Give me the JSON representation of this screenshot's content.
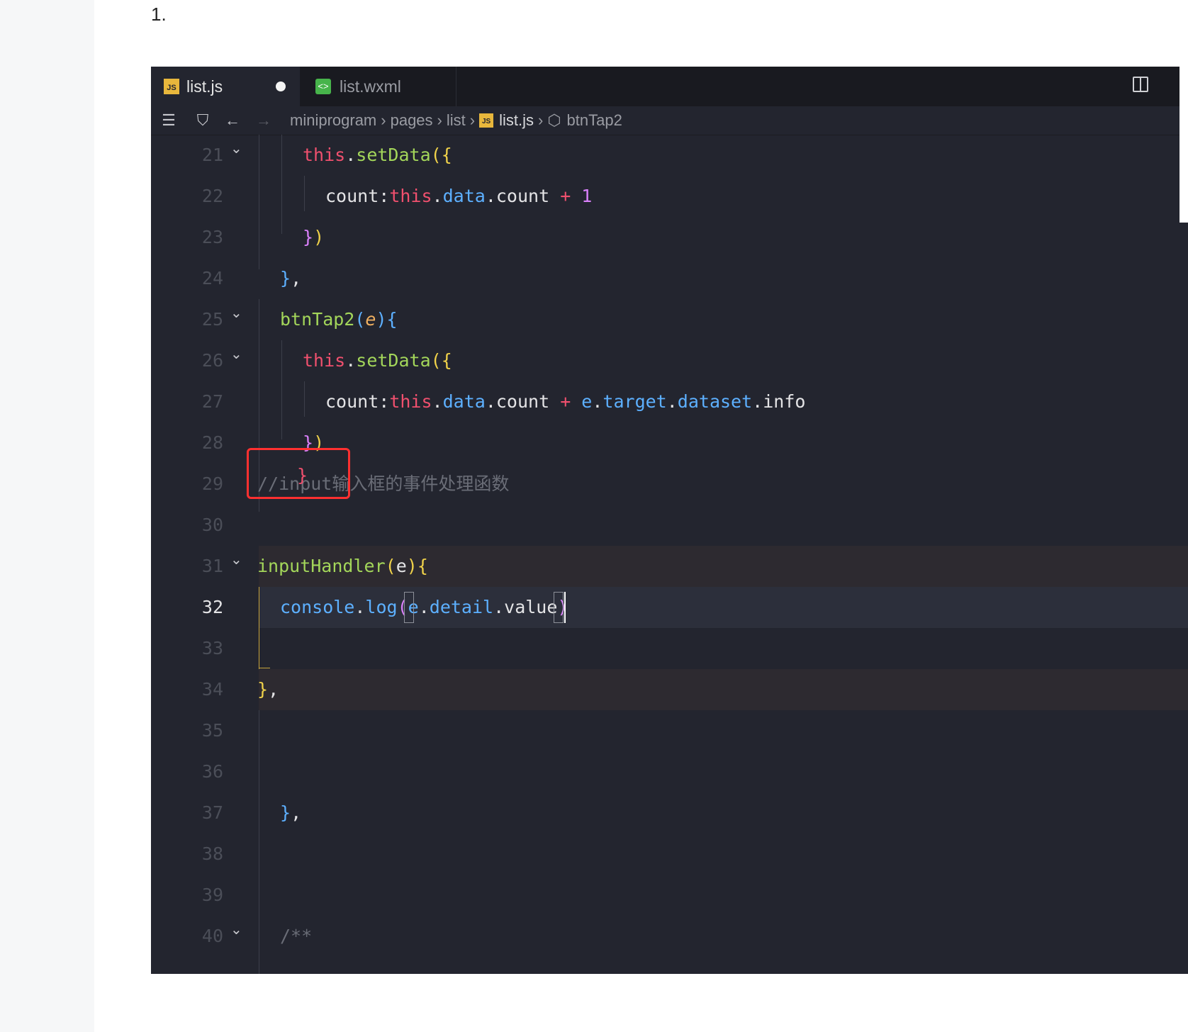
{
  "list_marker": "1.",
  "tabs": [
    {
      "label": "list.js",
      "icon": "js-file-icon",
      "active": true,
      "dirty": true
    },
    {
      "label": "list.wxml",
      "icon": "wxml-file-icon",
      "active": false
    }
  ],
  "breadcrumb": {
    "parts": [
      "miniprogram",
      "pages",
      "list",
      "list.js",
      "btnTap2"
    ],
    "icons": [
      "list-icon",
      "bookmark-icon",
      "back-arrow-icon",
      "forward-arrow-icon"
    ]
  },
  "code": {
    "current_line": 32,
    "lines": [
      {
        "n": "21",
        "fold": true
      },
      {
        "n": "22",
        "fold": false
      },
      {
        "n": "23",
        "fold": false
      },
      {
        "n": "24",
        "fold": false
      },
      {
        "n": "25",
        "fold": true
      },
      {
        "n": "26",
        "fold": true
      },
      {
        "n": "27",
        "fold": false
      },
      {
        "n": "28",
        "fold": false
      },
      {
        "n": "29",
        "fold": false
      },
      {
        "n": "30",
        "fold": false
      },
      {
        "n": "31",
        "fold": true
      },
      {
        "n": "32",
        "fold": false
      },
      {
        "n": "33",
        "fold": false
      },
      {
        "n": "34",
        "fold": false
      },
      {
        "n": "35",
        "fold": false
      },
      {
        "n": "36",
        "fold": false
      },
      {
        "n": "37",
        "fold": false
      },
      {
        "n": "38",
        "fold": false
      },
      {
        "n": "39",
        "fold": false
      },
      {
        "n": "40",
        "fold": true
      }
    ],
    "tokens": {
      "l21": [
        "this",
        ".",
        "setData",
        "(",
        "{"
      ],
      "l22": [
        "count:",
        "this",
        ".",
        "data",
        ".",
        "count",
        " + ",
        "1"
      ],
      "l23": [
        "}",
        ")"
      ],
      "l24": [
        "}",
        ","
      ],
      "l25": [
        "btnTap2",
        "(",
        "e",
        ")",
        "{"
      ],
      "l26": [
        "this",
        ".",
        "setData",
        "(",
        "{"
      ],
      "l27": [
        "count:",
        "this",
        ".",
        "data",
        ".",
        "count",
        " + ",
        "e",
        ".",
        "target",
        ".",
        "dataset",
        ".",
        "info"
      ],
      "l28": [
        "}",
        ")"
      ],
      "l29": [
        "//input输入框的事件处理函数",
        "}"
      ],
      "l31": [
        "inputHandler",
        "(",
        "e",
        ")",
        "{"
      ],
      "l32": [
        "console",
        ".",
        "log",
        "(",
        "e",
        ".",
        "detail",
        ".",
        "value",
        ")"
      ],
      "l34": [
        "}",
        ","
      ],
      "l37": [
        "}",
        ","
      ],
      "l40": [
        "/**"
      ]
    }
  },
  "colors": {
    "editor_bg": "#23252f",
    "tabbar_bg": "#191a20",
    "keyword": "#f0506e",
    "function": "#a3d65a",
    "property": "#5db0ff",
    "brace": "#f0d24a",
    "comment": "#6a6d77",
    "annotation": "#ff3030"
  }
}
